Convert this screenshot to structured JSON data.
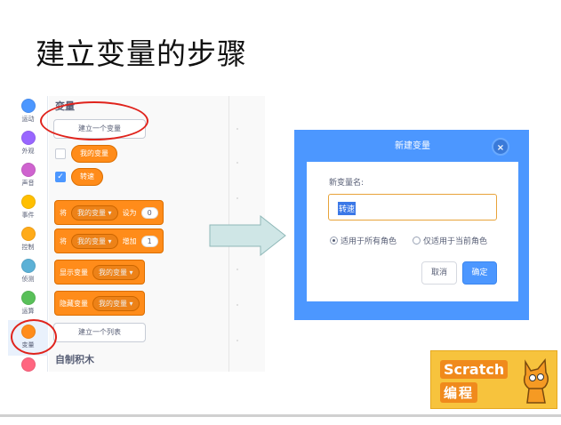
{
  "slide": {
    "title": "建立变量的步骤"
  },
  "categories": [
    {
      "label": "运动",
      "color": "#4c97ff"
    },
    {
      "label": "外观",
      "color": "#9966ff"
    },
    {
      "label": "声音",
      "color": "#cf63cf"
    },
    {
      "label": "事件",
      "color": "#ffbf00"
    },
    {
      "label": "控制",
      "color": "#ffab19"
    },
    {
      "label": "侦测",
      "color": "#5cb1d6"
    },
    {
      "label": "运算",
      "color": "#59c059"
    },
    {
      "label": "变量",
      "color": "#ff8c1a"
    },
    {
      "label": "",
      "color": "#ff6680"
    }
  ],
  "palette": {
    "section_variables": "变量",
    "make_variable": "建立一个变量",
    "var_my": "我的变量",
    "var_spin": "转速",
    "set_block": {
      "prefix": "将",
      "var": "我的变量 ▾",
      "op": "设为",
      "value": "0"
    },
    "change_block": {
      "prefix": "将",
      "var": "我的变量 ▾",
      "op": "增加",
      "value": "1"
    },
    "show_block": {
      "label": "显示变量",
      "var": "我的变量 ▾"
    },
    "hide_block": {
      "label": "隐藏变量",
      "var": "我的变量 ▾"
    },
    "make_list": "建立一个列表",
    "section_myblocks": "自制积木"
  },
  "dialog": {
    "title": "新建变量",
    "close": "×",
    "name_label": "新变量名:",
    "name_value": "转速",
    "radio_all": "适用于所有角色",
    "radio_current": "仅适用于当前角色",
    "cancel": "取消",
    "ok": "确定"
  },
  "logo": {
    "line1": "Scratch",
    "line2": "编程"
  },
  "colors": {
    "accent": "#4c97ff",
    "variables": "#ff8c1a",
    "highlight_ring": "#e0231c"
  }
}
